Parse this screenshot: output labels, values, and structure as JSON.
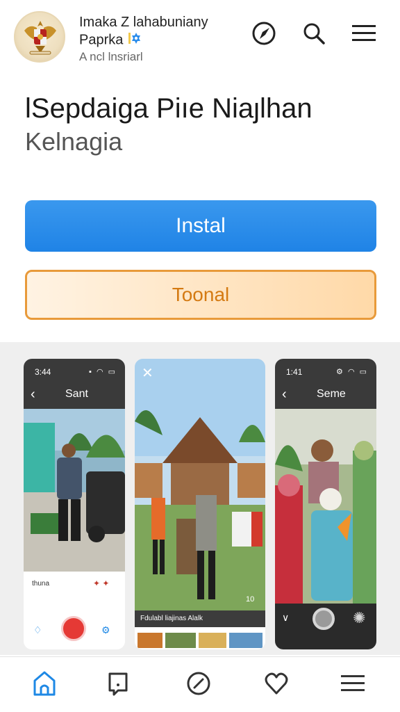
{
  "header": {
    "app_name": "Imaka Z lahabuniany",
    "app_name_line2": "Paprka",
    "publisher": "A ncl lnsriarl"
  },
  "main": {
    "title": "lSepdaiga Piıe Niaȷlhan",
    "subtitle": "Kelnagia",
    "install_label": "Instal",
    "trial_label": "Toonal"
  },
  "gallery": {
    "shot1": {
      "time": "3:44",
      "title": "Sant",
      "caption": "thuna"
    },
    "shot2": {
      "caption": "Fdulabl liajinas Alalk",
      "badge": "10"
    },
    "shot3": {
      "time": "1:41",
      "title": "Seme"
    }
  },
  "icons": {
    "logo": "garuda-emblem-icon",
    "verified": "verified-badge-icon",
    "header": [
      "compass-icon",
      "search-icon",
      "menu-icon"
    ],
    "nav": [
      "home-icon",
      "library-icon",
      "explore-icon",
      "wishlist-icon",
      "menu-icon"
    ]
  },
  "colors": {
    "install": "#2a8ceb",
    "trial_border": "#e89a3a",
    "trial_text": "#d47a12",
    "nav_active": "#1e88e5"
  }
}
